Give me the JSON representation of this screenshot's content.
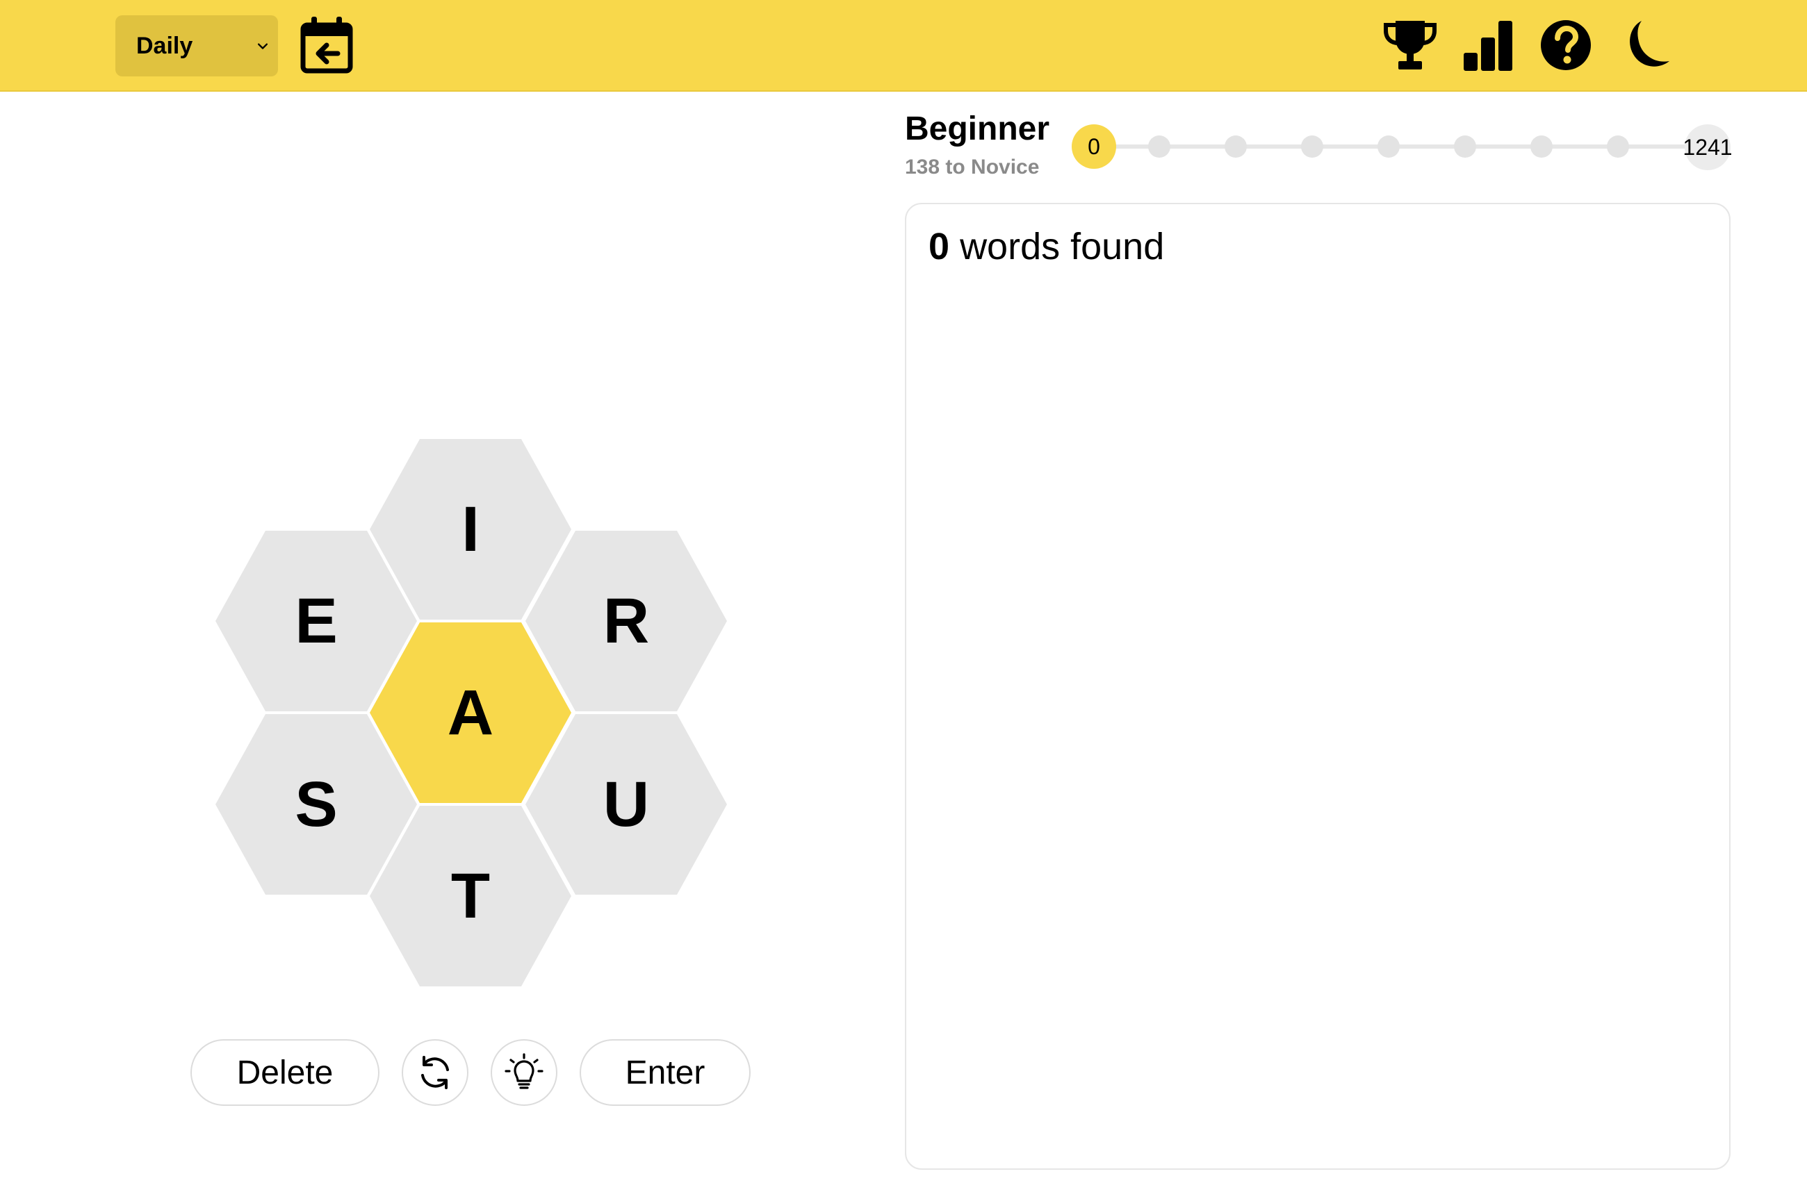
{
  "header": {
    "mode_select": "Daily",
    "icons": {
      "calendar": "calendar-back-icon",
      "trophy": "trophy-icon",
      "stats": "bar-chart-icon",
      "help": "help-circle-icon",
      "theme": "moon-icon"
    },
    "bg_color": "#f8d84b"
  },
  "hive": {
    "center_letter": "A",
    "outer_letters": {
      "top": "I",
      "upper_left": "E",
      "upper_right": "R",
      "lower_left": "S",
      "lower_right": "U",
      "bottom": "T"
    },
    "center_color": "#f8d84b",
    "outer_color": "#e6e6e6"
  },
  "controls": {
    "delete_label": "Delete",
    "enter_label": "Enter",
    "shuffle_icon": "shuffle-icon",
    "hint_icon": "lightbulb-icon"
  },
  "rank": {
    "title": "Beginner",
    "next": "138 to Novice",
    "current_score": "0",
    "max_score": "1241"
  },
  "words": {
    "count": "0",
    "label": "words found"
  }
}
